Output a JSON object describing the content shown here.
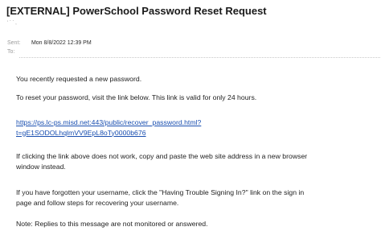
{
  "email": {
    "subject": "[EXTERNAL] PowerSchool Password Reset Request",
    "sender_faded": "' ` ` ,",
    "sent_label": "Sent:",
    "sent_value": "Mon 8/8/2022 12:39 PM",
    "to_label": "To:",
    "to_value": ""
  },
  "body": {
    "p1": "You recently requested a new password.",
    "p2": "To reset your password, visit the link below. This link is valid for only 24 hours.",
    "link_line1": "https://ps.lc-ps.misd.net:443/public/recover_password.html?",
    "link_line2": "t=gE1SODOLhqlmVV9EpL8oTy0000b676",
    "p4_line1": "If clicking the link above does not work, copy and paste the web site address in a new browser",
    "p4_line2": "window instead.",
    "p5_line1": "If you have forgotten your username, click the \"Having Trouble Signing In?\" link on the sign in",
    "p5_line2": "page and follow steps for recovering your username.",
    "p6": "Note:  Replies to this message are not monitored or answered."
  },
  "colors": {
    "link": "#1a4fb0",
    "text": "#222222",
    "muted": "#9a9a9a"
  }
}
